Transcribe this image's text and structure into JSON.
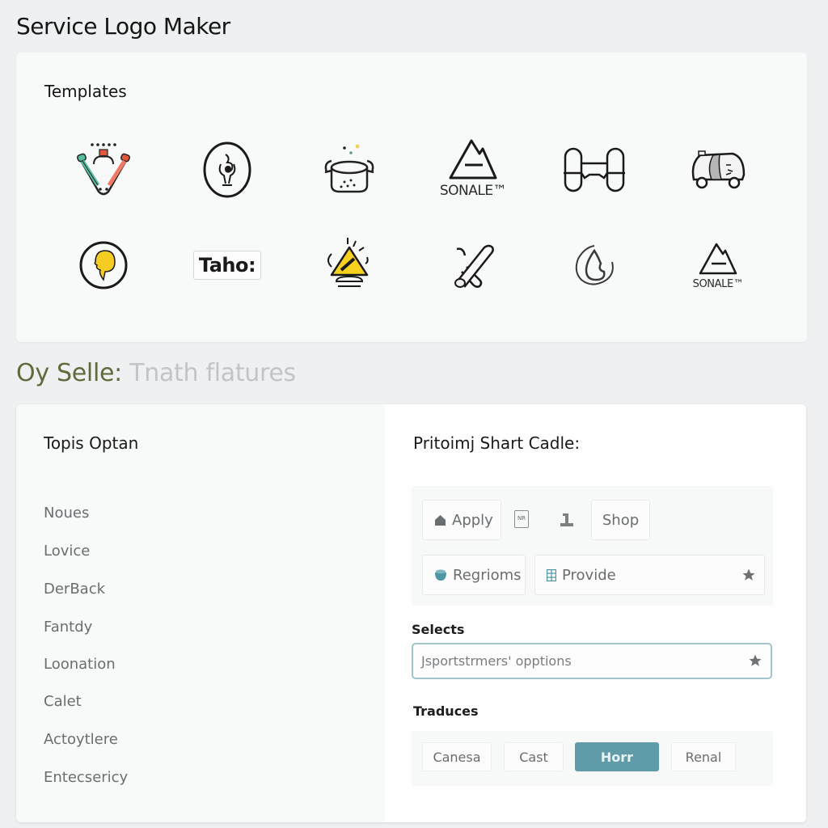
{
  "app": {
    "title": "Service Logo Maker"
  },
  "templates": {
    "title": "Templates",
    "logos": [
      {
        "name": "tools-v-logo",
        "label": ""
      },
      {
        "name": "emblem-oval-logo",
        "label": ""
      },
      {
        "name": "pot-logo",
        "label": ""
      },
      {
        "name": "mountain-logo",
        "label": "SONALE™"
      },
      {
        "name": "dumbbell-frame-logo",
        "label": ""
      },
      {
        "name": "vehicle-logo",
        "label": ""
      },
      {
        "name": "yellow-circle-logo",
        "label": ""
      },
      {
        "name": "wordmark-logo",
        "label": "Taho:"
      },
      {
        "name": "warning-sign-logo",
        "label": ""
      },
      {
        "name": "crossed-tools-logo",
        "label": ""
      },
      {
        "name": "drop-logo",
        "label": ""
      },
      {
        "name": "mountain-logo-small",
        "label": "SONALE™"
      }
    ]
  },
  "section": {
    "heading_accent": "Oy Selle:",
    "heading_muted": "Tnath flatures"
  },
  "options": {
    "title": "Topis Optan",
    "items": [
      "Noues",
      "Lovice",
      "DerBack",
      "Fantdy",
      "Loonation",
      "Calet",
      "Actoytlere",
      "Entecsericy"
    ]
  },
  "panel": {
    "title": "Pritoimj Shart Cadle:",
    "toolbar": {
      "apply_label": "Apply",
      "badge_icon_text": "NR",
      "shop_label": "Shop",
      "regions_label": "Regrioms",
      "provide_label": "Provide"
    },
    "selects": {
      "label": "Selects",
      "value": "Jsportstrmers' opptions"
    },
    "traduces": {
      "label": "Traduces",
      "chips": [
        {
          "label": "Canesa",
          "active": false
        },
        {
          "label": "Cast",
          "active": false
        },
        {
          "label": "Horr",
          "active": true
        },
        {
          "label": "Renal",
          "active": false
        }
      ]
    }
  },
  "colors": {
    "accent_teal": "#5f9ca8",
    "heading_olive": "#5f6b3c",
    "focus_border": "#a3c4cb"
  }
}
